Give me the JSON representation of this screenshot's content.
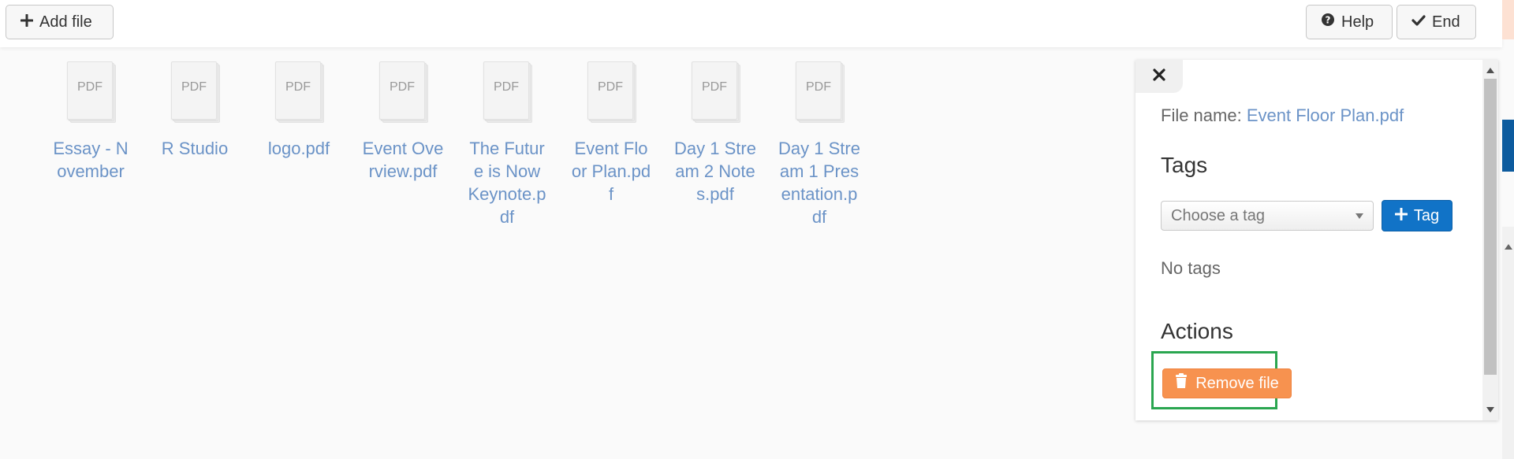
{
  "toolbar": {
    "add_file_label": "Add file",
    "help_label": "Help",
    "end_label": "End",
    "icons": {
      "add": "plus-icon",
      "help": "question-circle-icon",
      "end": "check-icon"
    }
  },
  "files": [
    {
      "ext": "PDF",
      "name": "Essay - November"
    },
    {
      "ext": "PDF",
      "name": "R Studio"
    },
    {
      "ext": "PDF",
      "name": "logo.pdf"
    },
    {
      "ext": "PDF",
      "name": "Event Overview.pdf"
    },
    {
      "ext": "PDF",
      "name": "The Future is Now Keynote.pdf"
    },
    {
      "ext": "PDF",
      "name": "Event Floor Plan.pdf"
    },
    {
      "ext": "PDF",
      "name": "Day 1 Stream 2 Notes.pdf"
    },
    {
      "ext": "PDF",
      "name": "Day 1 Stream 1 Presentation.pdf"
    }
  ],
  "panel": {
    "file_name_label": "File name:",
    "file_name_value": "Event Floor Plan.pdf",
    "tags_heading": "Tags",
    "tag_select_placeholder": "Choose a tag",
    "tag_button_label": "Tag",
    "no_tags_text": "No tags",
    "actions_heading": "Actions",
    "remove_button_label": "Remove file",
    "icons": {
      "close": "close-icon",
      "tag": "plus-icon",
      "remove": "trash-icon"
    }
  },
  "colors": {
    "link": "#6b93c7",
    "primary": "#1173c7",
    "danger": "#f7924f",
    "highlight": "#2aa650"
  }
}
